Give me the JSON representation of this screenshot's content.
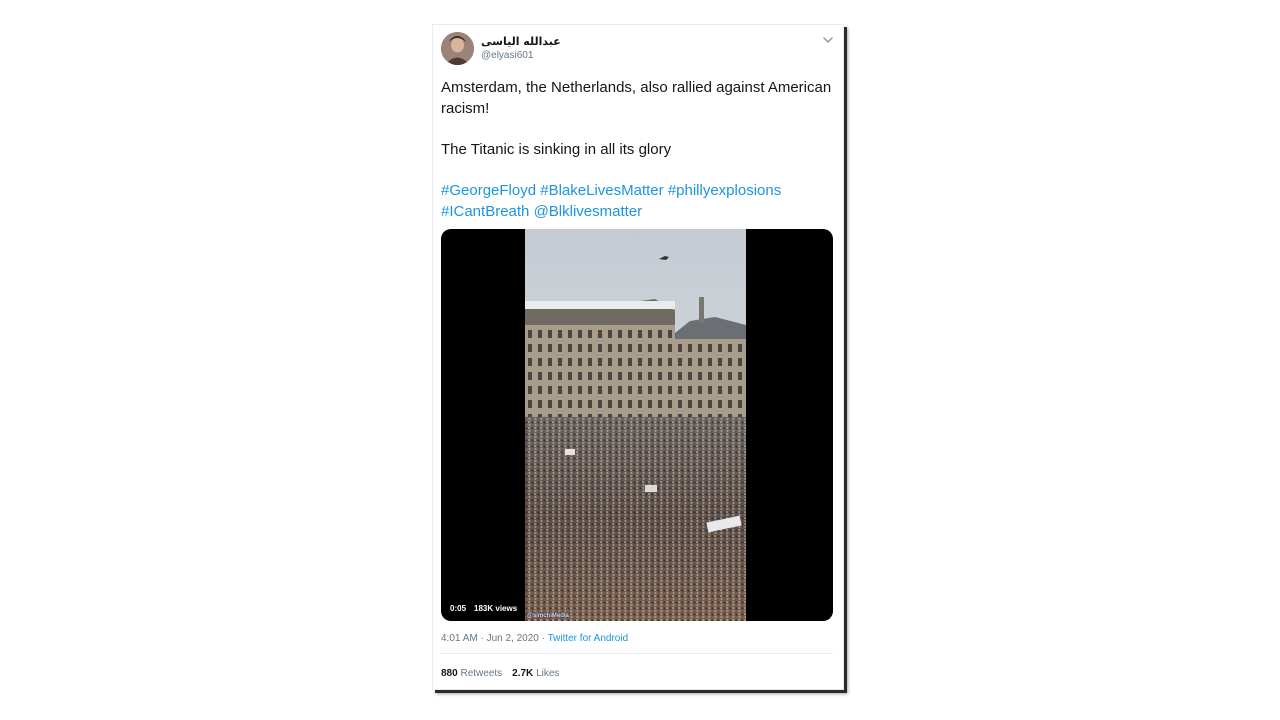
{
  "author": {
    "display_name": "عبدالله الياسى",
    "handle": "@elyasi601",
    "avatar_icon": "user-avatar"
  },
  "tweet": {
    "line1": "Amsterdam, the Netherlands, also rallied against American racism!",
    "line2": "The Titanic is sinking in all its glory",
    "hashtags": [
      "#GeorgeFloyd",
      "#BlakeLivesMatter",
      "#phillyexplosions",
      "#ICantBreath",
      "@Blklivesmatter"
    ]
  },
  "video": {
    "time": "0:05",
    "views": "183K views",
    "watermark": "@simchiMedia"
  },
  "meta": {
    "timestamp": "4:01 AM · Jun 2, 2020 · ",
    "source": "Twitter for Android"
  },
  "stats": {
    "retweets_count": "880",
    "retweets_label": "Retweets",
    "likes_count": "2.7K",
    "likes_label": "Likes"
  },
  "colors": {
    "link": "#1b95e0",
    "text": "#14171a",
    "muted": "#657786"
  }
}
